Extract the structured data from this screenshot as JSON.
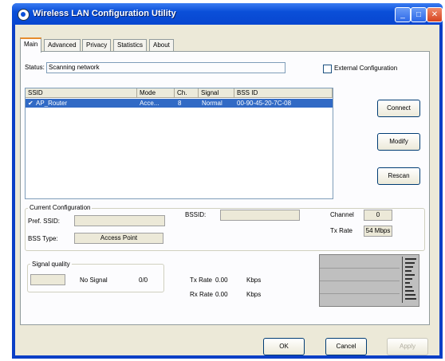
{
  "window": {
    "title": "Wireless LAN Configuration Utility"
  },
  "tabs": [
    "Main",
    "Advanced",
    "Privacy",
    "Statistics",
    "About"
  ],
  "status": {
    "label": "Status:",
    "value": "Scanning network"
  },
  "external_config": {
    "label": "External Configuration",
    "checked": false
  },
  "network_list": {
    "columns": [
      "SSID",
      "Mode",
      "Ch.",
      "Signal",
      "BSS ID"
    ],
    "rows": [
      {
        "ssid": "AP_Router",
        "mode": "Acce...",
        "ch": "8",
        "signal": "Normal",
        "bssid": "00-90-45-20-7C-08",
        "selected": true
      }
    ]
  },
  "buttons": {
    "connect": "Connect",
    "modify": "Modify",
    "rescan": "Rescan",
    "ok": "OK",
    "cancel": "Cancel",
    "apply": "Apply"
  },
  "current_config": {
    "title": "Current Configuration",
    "pref_ssid_label": "Pref. SSID:",
    "pref_ssid_value": "",
    "bssid_label": "BSSID:",
    "bssid_value": "",
    "channel_label": "Channel",
    "channel_value": "0",
    "bss_type_label": "BSS Type:",
    "bss_type_value": "Access Point",
    "tx_rate_label": "Tx Rate",
    "tx_rate_value": "54 Mbps"
  },
  "signal": {
    "quality_label": "Signal quality",
    "status": "No Signal",
    "ratio": "0/0",
    "tx_label": "Tx Rate",
    "tx_value": "0.00",
    "tx_unit": "Kbps",
    "rx_label": "Rx Rate",
    "rx_value": "0.00",
    "rx_unit": "Kbps"
  },
  "colors": {
    "titlebar": "#0a4fd8",
    "selection": "#316ac5",
    "tab_accent": "#e68b2c"
  }
}
